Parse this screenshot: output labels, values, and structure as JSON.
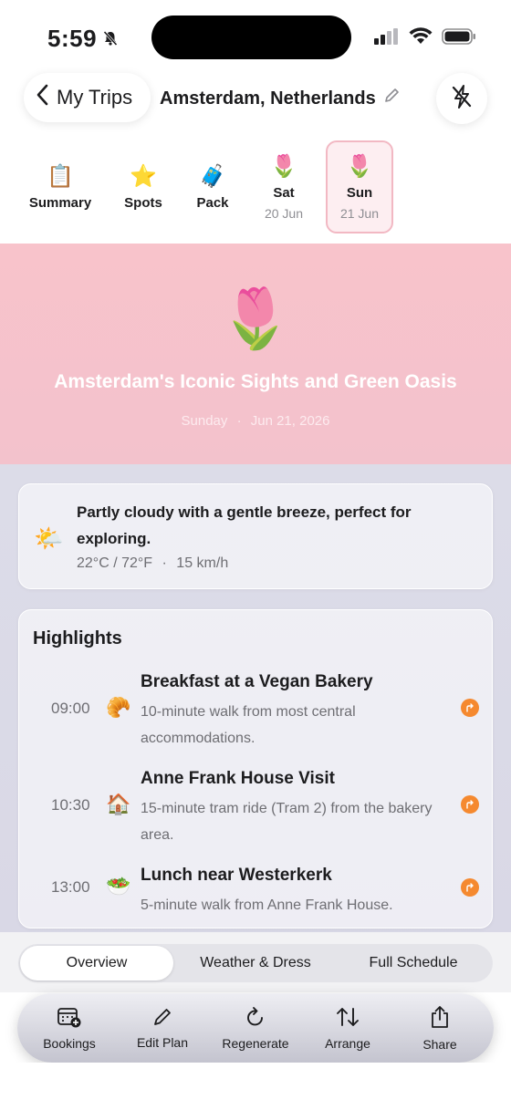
{
  "status": {
    "time": "5:59"
  },
  "header": {
    "back_label": "My Trips",
    "trip_title": "Amsterdam, Netherlands"
  },
  "tabs": [
    {
      "emoji": "📋",
      "label": "Summary",
      "sub": ""
    },
    {
      "emoji": "⭐",
      "label": "Spots",
      "sub": ""
    },
    {
      "emoji": "🧳",
      "label": "Pack",
      "sub": ""
    },
    {
      "emoji": "🌷",
      "label": "Sat",
      "sub": "20 Jun"
    },
    {
      "emoji": "🌷",
      "label": "Sun",
      "sub": "21 Jun"
    }
  ],
  "hero": {
    "emoji": "🌷",
    "title": "Amsterdam's Iconic Sights and Green Oasis",
    "day": "Sunday",
    "date": "Jun 21, 2026"
  },
  "weather": {
    "icon": "🌤️",
    "summary": "Partly cloudy with a gentle breeze, perfect for exploring.",
    "temp": "22°C / 72°F",
    "wind": "15 km/h"
  },
  "highlights": {
    "title": "Highlights",
    "items": [
      {
        "time": "09:00",
        "emoji": "🥐",
        "name": "Breakfast at a Vegan Bakery",
        "desc": "10-minute walk from most central accommodations."
      },
      {
        "time": "10:30",
        "emoji": "🏠",
        "name": "Anne Frank House Visit",
        "desc": "15-minute tram ride (Tram 2) from the bakery area."
      },
      {
        "time": "13:00",
        "emoji": "🥗",
        "name": "Lunch near Westerkerk",
        "desc": "5-minute walk from Anne Frank House."
      }
    ]
  },
  "segments": {
    "overview": "Overview",
    "weather": "Weather & Dress",
    "schedule": "Full Schedule"
  },
  "toolbar": {
    "bookings": "Bookings",
    "edit": "Edit Plan",
    "regenerate": "Regenerate",
    "arrange": "Arrange",
    "share": "Share"
  },
  "colors": {
    "accent_pink": "#f8c3cb",
    "route_orange": "#f5892f"
  }
}
